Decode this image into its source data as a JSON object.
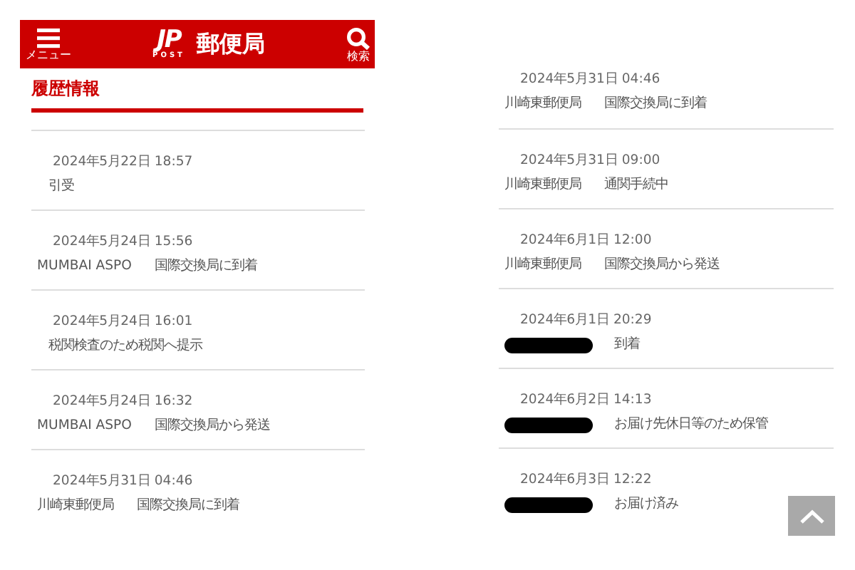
{
  "header": {
    "menu_label": "メニュー",
    "logo_mark": "JP",
    "logo_sub": "POST",
    "brand": "郵便局",
    "search_label": "検索"
  },
  "section_title": "履歴情報",
  "panels": [
    {
      "events": [
        {
          "datetime": "2024年5月22日 18:57",
          "redacted": false,
          "event": "引受"
        },
        {
          "datetime": "2024年5月24日 15:56",
          "office": "MUMBAI ASPO",
          "redacted": false,
          "event": "国際交換局に到着"
        },
        {
          "datetime": "2024年5月24日 16:01",
          "redacted": false,
          "event": "税関検査のため税関へ提示"
        },
        {
          "datetime": "2024年5月24日 16:32",
          "office": "MUMBAI ASPO",
          "redacted": false,
          "event": "国際交換局から発送"
        },
        {
          "datetime": "2024年5月31日 04:46",
          "office": "川崎東郵便局",
          "redacted": false,
          "event": "国際交換局に到着"
        }
      ]
    },
    {
      "events": [
        {
          "datetime": "2024年5月31日 04:46",
          "office": "川崎東郵便局",
          "redacted": false,
          "event": "国際交換局に到着"
        },
        {
          "datetime": "2024年5月31日 09:00",
          "office": "川崎東郵便局",
          "redacted": false,
          "event": "通関手続中"
        },
        {
          "datetime": "2024年6月1日 12:00",
          "office": "川崎東郵便局",
          "redacted": false,
          "event": "国際交換局から発送"
        },
        {
          "datetime": "2024年6月1日 20:29",
          "redacted": true,
          "event": "到着"
        },
        {
          "datetime": "2024年6月2日 14:13",
          "redacted": true,
          "event": "お届け先休日等のため保管"
        },
        {
          "datetime": "2024年6月3日 12:22",
          "redacted": true,
          "event": "お届け済み"
        }
      ]
    }
  ]
}
